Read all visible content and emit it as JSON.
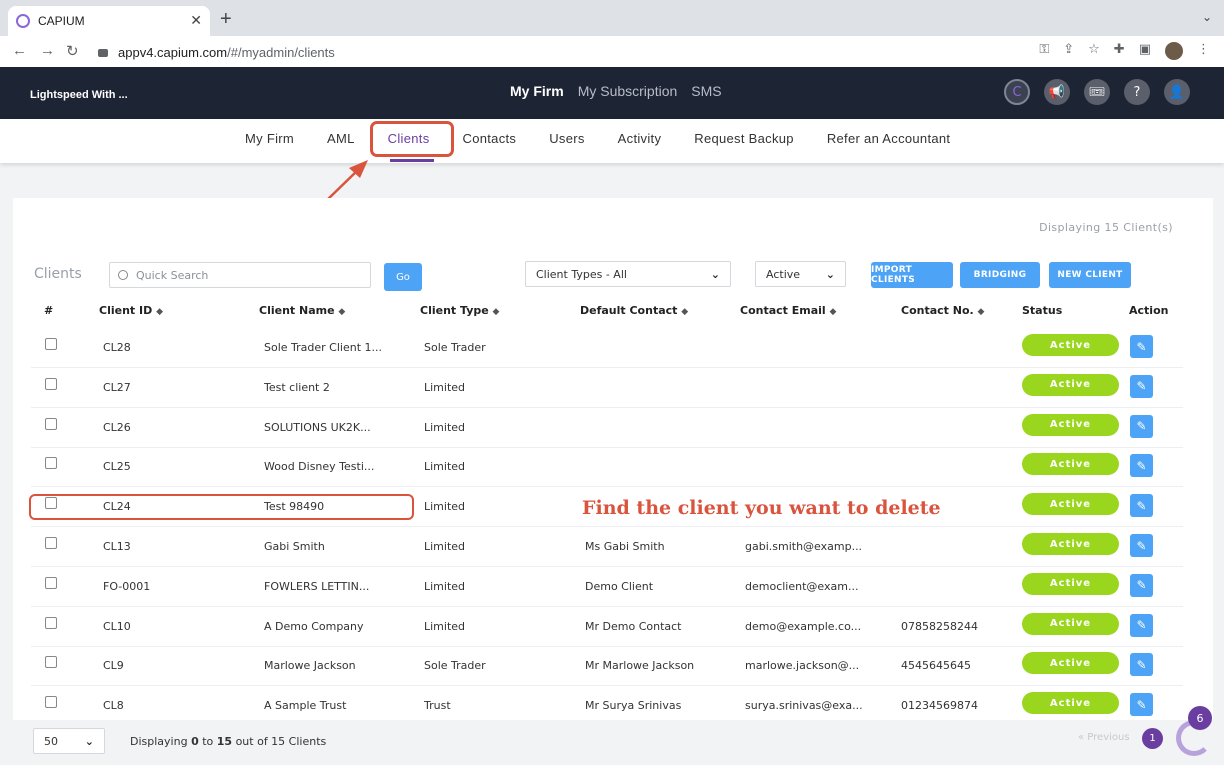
{
  "browser": {
    "tab_title": "CAPIUM",
    "url_host": "appv4.capium.com",
    "url_path": "/#/myadmin/clients"
  },
  "header": {
    "firm_name": "Lightspeed With ...",
    "nav": [
      "My Firm",
      "My Subscription",
      "SMS"
    ]
  },
  "subnav": [
    "My Firm",
    "AML",
    "Clients",
    "Contacts",
    "Users",
    "Activity",
    "Request Backup",
    "Refer an Accountant"
  ],
  "page": {
    "displaying_top": "Displaying 15 Client(s)",
    "title": "Clients",
    "search_placeholder": "Quick Search",
    "go_label": "Go",
    "client_types": "Client Types - All",
    "status_filter": "Active",
    "import_label": "IMPORT CLIENTS",
    "bridging_label": "BRIDGING",
    "new_client_label": "NEW CLIENT"
  },
  "table": {
    "headers": [
      "#",
      "Client ID",
      "Client Name",
      "Client Type",
      "Default Contact",
      "Contact Email",
      "Contact No.",
      "Status",
      "Action"
    ],
    "rows": [
      {
        "id": "CL28",
        "name": "Sole Trader Client 1...",
        "type": "Sole Trader",
        "contact": "",
        "email": "",
        "phone": "",
        "status": "Active"
      },
      {
        "id": "CL27",
        "name": "Test client 2",
        "type": "Limited",
        "contact": "",
        "email": "",
        "phone": "",
        "status": "Active"
      },
      {
        "id": "CL26",
        "name": "SOLUTIONS UK2K...",
        "type": "Limited",
        "contact": "",
        "email": "",
        "phone": "",
        "status": "Active"
      },
      {
        "id": "CL25",
        "name": "Wood Disney Testi...",
        "type": "Limited",
        "contact": "",
        "email": "",
        "phone": "",
        "status": "Active"
      },
      {
        "id": "CL24",
        "name": "Test 98490",
        "type": "Limited",
        "contact": "",
        "email": "",
        "phone": "",
        "status": "Active"
      },
      {
        "id": "CL13",
        "name": "Gabi Smith",
        "type": "Limited",
        "contact": "Ms Gabi Smith",
        "email": "gabi.smith@examp...",
        "phone": "",
        "status": "Active"
      },
      {
        "id": "FO-0001",
        "name": "FOWLERS LETTIN...",
        "type": "Limited",
        "contact": "Demo Client",
        "email": "democlient@exam...",
        "phone": "",
        "status": "Active"
      },
      {
        "id": "CL10",
        "name": "A Demo Company",
        "type": "Limited",
        "contact": "Mr Demo Contact",
        "email": "demo@example.co...",
        "phone": "07858258244",
        "status": "Active"
      },
      {
        "id": "CL9",
        "name": "Marlowe Jackson",
        "type": "Sole Trader",
        "contact": "Mr Marlowe Jackson",
        "email": "marlowe.jackson@...",
        "phone": "4545645645",
        "status": "Active"
      },
      {
        "id": "CL8",
        "name": "A Sample Trust",
        "type": "Trust",
        "contact": "Mr Surya Srinivas",
        "email": "surya.srinivas@exa...",
        "phone": "01234569874",
        "status": "Active"
      }
    ]
  },
  "annotation": "Find the client you want to delete",
  "footer": {
    "per_page": "50",
    "info_prefix": "Displaying ",
    "info_from": "0",
    "info_mid": " to ",
    "info_to": "15",
    "info_suffix": " out of 15 Clients",
    "prev_label": "Previous",
    "page": "1",
    "chat_count": "6"
  },
  "colors": {
    "accent": "#6a3ea1",
    "button_blue": "#4da3f5",
    "status_green": "#9ad61e",
    "annotation_red": "#d9533d"
  }
}
